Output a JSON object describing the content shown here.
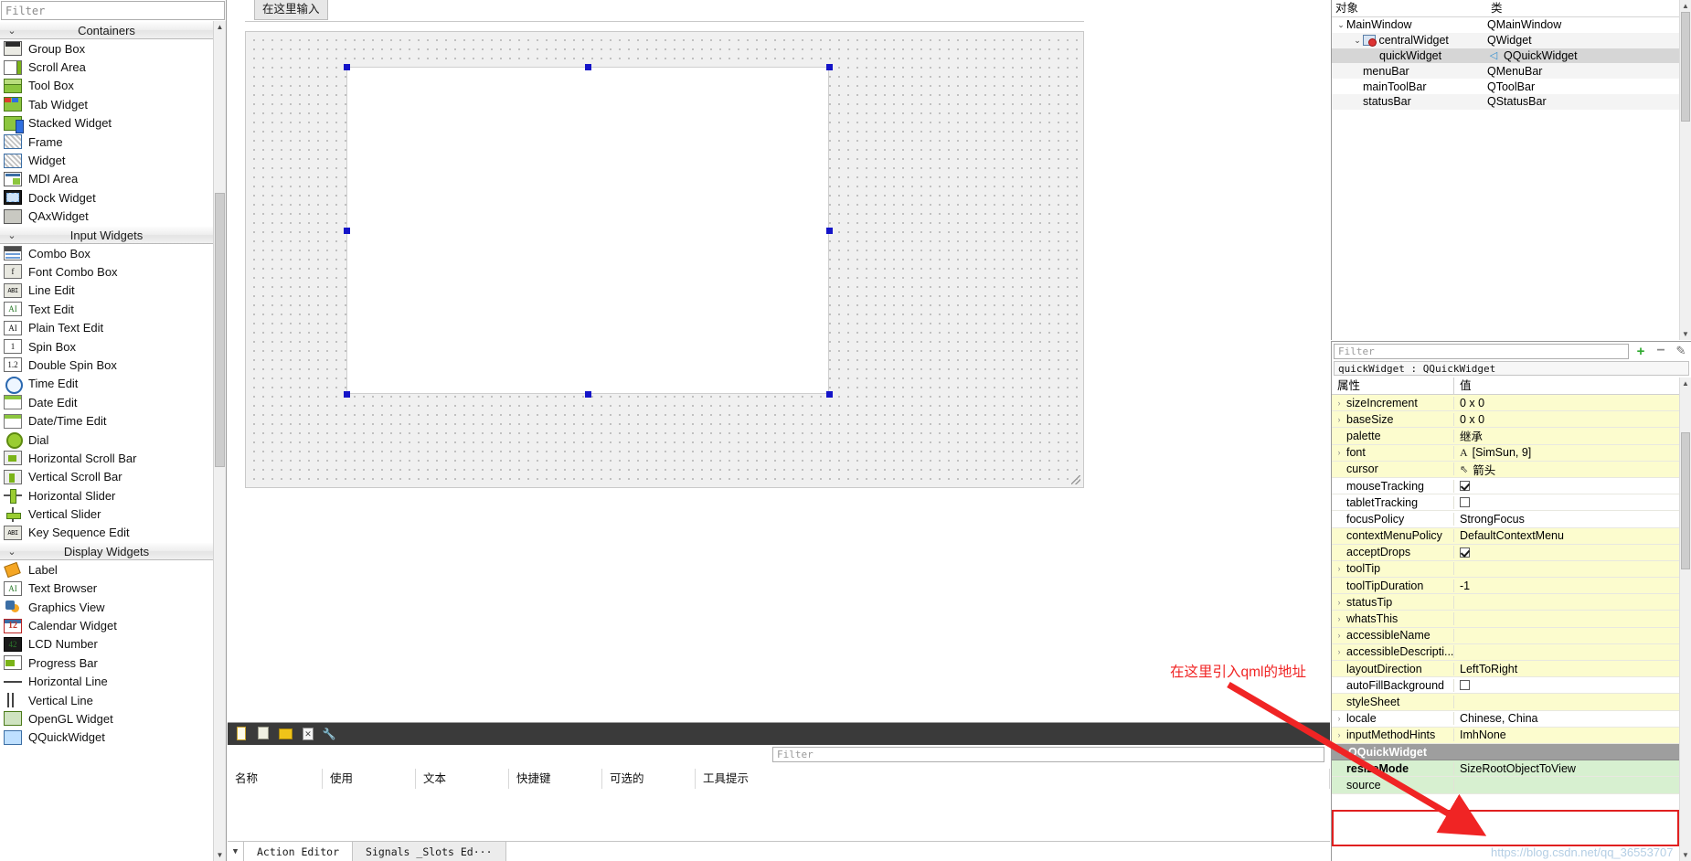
{
  "widget_box": {
    "filter_placeholder": "Filter",
    "groups": [
      {
        "title": "Containers",
        "items": [
          {
            "label": "Group Box",
            "icon": "groupbox-icon"
          },
          {
            "label": "Scroll Area",
            "icon": "scroll-area-icon"
          },
          {
            "label": "Tool Box",
            "icon": "tool-box-icon"
          },
          {
            "label": "Tab Widget",
            "icon": "tab-widget-icon"
          },
          {
            "label": "Stacked Widget",
            "icon": "stacked-widget-icon"
          },
          {
            "label": "Frame",
            "icon": "frame-icon"
          },
          {
            "label": "Widget",
            "icon": "widget-icon"
          },
          {
            "label": "MDI Area",
            "icon": "mdi-area-icon"
          },
          {
            "label": "Dock Widget",
            "icon": "dock-widget-icon"
          },
          {
            "label": "QAxWidget",
            "icon": "qax-widget-icon"
          }
        ]
      },
      {
        "title": "Input Widgets",
        "items": [
          {
            "label": "Combo Box",
            "icon": "combo-box-icon"
          },
          {
            "label": "Font Combo Box",
            "icon": "font-combo-box-icon"
          },
          {
            "label": "Line Edit",
            "icon": "line-edit-icon"
          },
          {
            "label": "Text Edit",
            "icon": "text-edit-icon"
          },
          {
            "label": "Plain Text Edit",
            "icon": "plain-text-edit-icon"
          },
          {
            "label": "Spin Box",
            "icon": "spin-box-icon"
          },
          {
            "label": "Double Spin Box",
            "icon": "double-spin-box-icon"
          },
          {
            "label": "Time Edit",
            "icon": "time-edit-icon"
          },
          {
            "label": "Date Edit",
            "icon": "date-edit-icon"
          },
          {
            "label": "Date/Time Edit",
            "icon": "date-time-edit-icon"
          },
          {
            "label": "Dial",
            "icon": "dial-icon"
          },
          {
            "label": "Horizontal Scroll Bar",
            "icon": "horizontal-scroll-bar-icon"
          },
          {
            "label": "Vertical Scroll Bar",
            "icon": "vertical-scroll-bar-icon"
          },
          {
            "label": "Horizontal Slider",
            "icon": "horizontal-slider-icon"
          },
          {
            "label": "Vertical Slider",
            "icon": "vertical-slider-icon"
          },
          {
            "label": "Key Sequence Edit",
            "icon": "key-sequence-edit-icon"
          }
        ]
      },
      {
        "title": "Display Widgets",
        "items": [
          {
            "label": "Label",
            "icon": "label-icon"
          },
          {
            "label": "Text Browser",
            "icon": "text-browser-icon"
          },
          {
            "label": "Graphics View",
            "icon": "graphics-view-icon"
          },
          {
            "label": "Calendar Widget",
            "icon": "calendar-widget-icon"
          },
          {
            "label": "LCD Number",
            "icon": "lcd-number-icon"
          },
          {
            "label": "Progress Bar",
            "icon": "progress-bar-icon"
          },
          {
            "label": "Horizontal Line",
            "icon": "horizontal-line-icon"
          },
          {
            "label": "Vertical Line",
            "icon": "vertical-line-icon"
          },
          {
            "label": "OpenGL Widget",
            "icon": "opengl-widget-icon"
          },
          {
            "label": "QQuickWidget",
            "icon": "qquick-widget-icon"
          }
        ]
      }
    ]
  },
  "form_editor": {
    "menu_placeholder": "在这里输入",
    "selected_widget": "quickWidget"
  },
  "action_editor": {
    "toolbar_icons": [
      "new-action-icon",
      "copy-action-icon",
      "edit-action-icon",
      "delete-action-icon",
      "configure-icon"
    ],
    "filter_placeholder": "Filter",
    "columns": [
      "名称",
      "使用",
      "文本",
      "快捷键",
      "可选的",
      "工具提示"
    ],
    "rows": [],
    "tabs": [
      {
        "label": "Action Editor",
        "active": true
      },
      {
        "label": "Signals _Slots Ed···",
        "active": false
      }
    ]
  },
  "object_inspector": {
    "columns": [
      "对象",
      "类"
    ],
    "rows": [
      {
        "name": "MainWindow",
        "class": "QMainWindow",
        "indent": 0,
        "chevron": "v",
        "icon": "",
        "selected": false
      },
      {
        "name": "centralWidget",
        "class": "QWidget",
        "indent": 1,
        "chevron": "v",
        "icon": "widget-no-layout-icon",
        "selected": false
      },
      {
        "name": "quickWidget",
        "class": "QQuickWidget",
        "indent": 2,
        "chevron": "",
        "icon": "qml-icon",
        "selected": true
      },
      {
        "name": "menuBar",
        "class": "QMenuBar",
        "indent": 1,
        "chevron": "",
        "icon": "",
        "selected": false
      },
      {
        "name": "mainToolBar",
        "class": "QToolBar",
        "indent": 1,
        "chevron": "",
        "icon": "",
        "selected": false
      },
      {
        "name": "statusBar",
        "class": "QStatusBar",
        "indent": 1,
        "chevron": "",
        "icon": "",
        "selected": false
      }
    ]
  },
  "property_editor": {
    "filter_placeholder": "Filter",
    "buttons": {
      "add": "+",
      "remove": "−",
      "configure": "configure-icon"
    },
    "object_line": "quickWidget : QQuickWidget",
    "columns": [
      "属性",
      "值"
    ],
    "rows": [
      {
        "key": "sizeIncrement",
        "value": "0 x 0",
        "chevron": true,
        "style": "yellow",
        "kind": "text"
      },
      {
        "key": "baseSize",
        "value": "0 x 0",
        "chevron": true,
        "style": "yellow",
        "kind": "text"
      },
      {
        "key": "palette",
        "value": "继承",
        "chevron": false,
        "style": "yellow",
        "kind": "text"
      },
      {
        "key": "font",
        "value": "[SimSun, 9]",
        "chevron": true,
        "style": "yellow",
        "kind": "font"
      },
      {
        "key": "cursor",
        "value": "箭头",
        "chevron": false,
        "style": "yellow",
        "kind": "cursor"
      },
      {
        "key": "mouseTracking",
        "value": "",
        "chevron": false,
        "style": "white",
        "kind": "checkbox-on"
      },
      {
        "key": "tabletTracking",
        "value": "",
        "chevron": false,
        "style": "white",
        "kind": "checkbox-off"
      },
      {
        "key": "focusPolicy",
        "value": "StrongFocus",
        "chevron": false,
        "style": "white",
        "kind": "text"
      },
      {
        "key": "contextMenuPolicy",
        "value": "DefaultContextMenu",
        "chevron": false,
        "style": "yellow",
        "kind": "text"
      },
      {
        "key": "acceptDrops",
        "value": "",
        "chevron": false,
        "style": "yellow",
        "kind": "checkbox-on"
      },
      {
        "key": "toolTip",
        "value": "",
        "chevron": true,
        "style": "yellow",
        "kind": "text"
      },
      {
        "key": "toolTipDuration",
        "value": "-1",
        "chevron": false,
        "style": "yellow",
        "kind": "text"
      },
      {
        "key": "statusTip",
        "value": "",
        "chevron": true,
        "style": "yellow",
        "kind": "text"
      },
      {
        "key": "whatsThis",
        "value": "",
        "chevron": true,
        "style": "yellow",
        "kind": "text"
      },
      {
        "key": "accessibleName",
        "value": "",
        "chevron": true,
        "style": "yellow",
        "kind": "text"
      },
      {
        "key": "accessibleDescripti...",
        "value": "",
        "chevron": true,
        "style": "yellow",
        "kind": "text"
      },
      {
        "key": "layoutDirection",
        "value": "LeftToRight",
        "chevron": false,
        "style": "yellow",
        "kind": "text"
      },
      {
        "key": "autoFillBackground",
        "value": "",
        "chevron": false,
        "style": "white",
        "kind": "checkbox-off"
      },
      {
        "key": "styleSheet",
        "value": "",
        "chevron": false,
        "style": "yellow",
        "kind": "text"
      },
      {
        "key": "locale",
        "value": "Chinese, China",
        "chevron": true,
        "style": "white",
        "kind": "text"
      },
      {
        "key": "inputMethodHints",
        "value": "ImhNone",
        "chevron": true,
        "style": "yellow",
        "kind": "text"
      },
      {
        "key": "QQuickWidget",
        "value": "",
        "chevron": true,
        "style": "group",
        "kind": "text"
      },
      {
        "key": "resizeMode",
        "value": "SizeRootObjectToView",
        "chevron": false,
        "style": "green",
        "kind": "bold"
      },
      {
        "key": "source",
        "value": "",
        "chevron": false,
        "style": "green",
        "kind": "text"
      }
    ]
  },
  "annotation": {
    "text": "在这里引入qml的地址",
    "color": "#f02424"
  },
  "watermark": {
    "text": "https://blog.csdn.net/qq_36553707"
  }
}
